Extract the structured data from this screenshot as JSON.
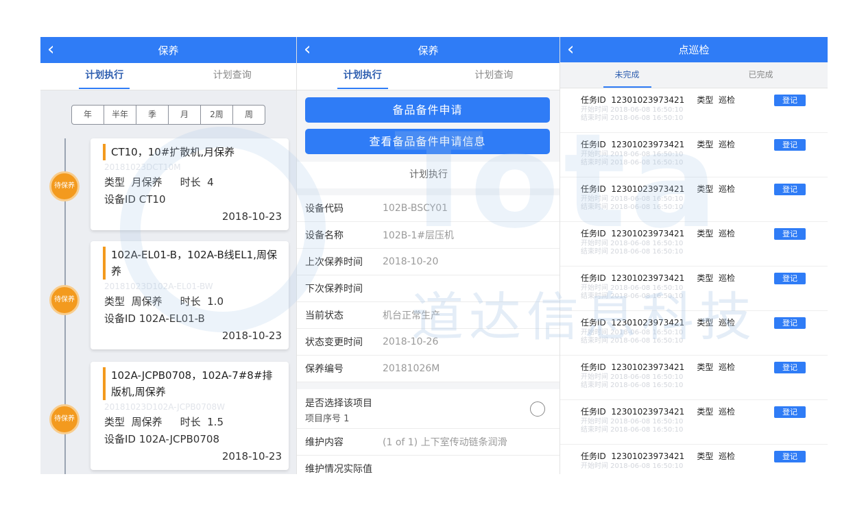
{
  "panel1": {
    "title": "保养",
    "tabs": [
      "计划执行",
      "计划查询"
    ],
    "segments": [
      "年",
      "半年",
      "季",
      "月",
      "2周",
      "周"
    ],
    "cards": [
      {
        "badge": "待保养",
        "title": "CT10，10#扩散机,月保养",
        "code": "20181023DCT10M",
        "type_label": "类型",
        "type_value": "月保养",
        "duration_label": "时长",
        "duration_value": "4",
        "device_label": "设备ID",
        "device_value": "CT10",
        "date": "2018-10-23"
      },
      {
        "badge": "待保养",
        "title": "102A-EL01-B，102A-B线EL1,周保养",
        "code": "20181023D102A-EL01-BW",
        "type_label": "类型",
        "type_value": "周保养",
        "duration_label": "时长",
        "duration_value": "1.0",
        "device_label": "设备ID",
        "device_value": "102A-EL01-B",
        "date": "2018-10-23"
      },
      {
        "badge": "待保养",
        "title": "102A-JCPB0708，102A-7#8#排版机,周保养",
        "code": "20181023D102A-JCPB0708W",
        "type_label": "类型",
        "type_value": "周保养",
        "duration_label": "时长",
        "duration_value": "1.5",
        "device_label": "设备ID",
        "device_value": "102A-JCPB0708",
        "date": "2018-10-23"
      }
    ]
  },
  "panel2": {
    "title": "保养",
    "tabs": [
      "计划执行",
      "计划查询"
    ],
    "buttons": [
      "备品备件申请",
      "查看备品备件申请信息"
    ],
    "section_title": "计划执行",
    "fields": [
      {
        "label": "设备代码",
        "value": "102B-BSCY01"
      },
      {
        "label": "设备名称",
        "value": "102B-1#层压机"
      },
      {
        "label": "上次保养时间",
        "value": "2018-10-20"
      },
      {
        "label": "下次保养时间",
        "value": ""
      },
      {
        "label": "当前状态",
        "value": "机台正常生产"
      },
      {
        "label": "状态变更时间",
        "value": "2018-10-26"
      },
      {
        "label": "保养编号",
        "value": "20181026M"
      }
    ],
    "item_select_label": "是否选择该项目",
    "item_index_label": "项目序号 1",
    "content_label": "维护内容",
    "content_value": "(1 of 1) 上下室传动链条润滑",
    "actual_label": "维护情况实际值"
  },
  "panel3": {
    "title": "点巡检",
    "tabs": [
      "未完成",
      "已完成"
    ],
    "task_id_label": "任务ID",
    "task_type_label": "类型",
    "register_label": "登记",
    "tasks": [
      {
        "id": "12301023973421",
        "type": "巡检",
        "start": "开始时间 2018-06-08 16:50:10",
        "end": "结束时间 2018-06-08 16:50:10"
      },
      {
        "id": "12301023973421",
        "type": "巡检",
        "start": "开始时间 2018-06-08 16:50:10",
        "end": "结束时间 2018-06-08 16:50:10"
      },
      {
        "id": "12301023973421",
        "type": "巡检",
        "start": "开始时间 2018-06-08 16:50:10",
        "end": "结束时间 2018-06-08 16:50:10"
      },
      {
        "id": "12301023973421",
        "type": "巡检",
        "start": "开始时间 2018-06-08 16:50:10",
        "end": "结束时间 2018-06-08 16:50:10"
      },
      {
        "id": "12301023973421",
        "type": "巡检",
        "start": "开始时间 2018-06-08 16:50:10",
        "end": "结束时间 2018-06-08 16:50:10"
      },
      {
        "id": "12301023973421",
        "type": "巡检",
        "start": "开始时间 2018-06-08 16:50:10",
        "end": "结束时间 2018-06-08 16:50:10"
      },
      {
        "id": "12301023973421",
        "type": "巡检",
        "start": "开始时间 2018-06-08 16:50:10",
        "end": "结束时间 2018-06-08 16:50:10"
      },
      {
        "id": "12301023973421",
        "type": "巡检",
        "start": "开始时间 2018-06-08 16:50:10",
        "end": "结束时间 2018-06-08 16:50:10"
      },
      {
        "id": "12301023973421",
        "type": "巡检",
        "start": "开始时间 2018-06-08 16:50:10",
        "end": ""
      }
    ]
  },
  "watermark": {
    "letters": "Tota",
    "cn": "道达信息科技"
  },
  "icons": {
    "back": "chevron-left-icon",
    "radio": "radio-unchecked-icon"
  },
  "colors": {
    "primary": "#2f7cf6",
    "accent_orange": "#f39a1e"
  }
}
